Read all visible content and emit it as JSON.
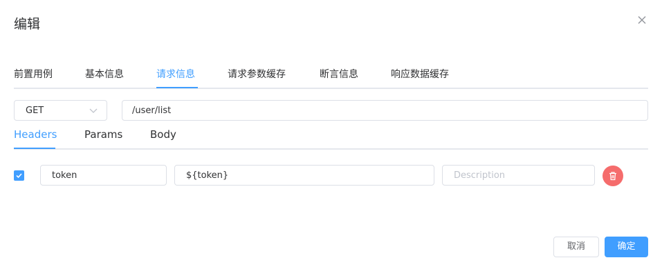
{
  "dialog": {
    "title": "编辑"
  },
  "tabs": [
    {
      "label": "前置用例"
    },
    {
      "label": "基本信息"
    },
    {
      "label": "请求信息",
      "active": true
    },
    {
      "label": "请求参数缓存"
    },
    {
      "label": "断言信息"
    },
    {
      "label": "响应数据缓存"
    }
  ],
  "request": {
    "method": "GET",
    "url": "/user/list"
  },
  "subtabs": [
    {
      "label": "Headers",
      "active": true
    },
    {
      "label": "Params"
    },
    {
      "label": "Body"
    }
  ],
  "headers": [
    {
      "enabled": true,
      "key": "token",
      "value": "${token}",
      "description": "",
      "description_placeholder": "Description"
    }
  ],
  "footer": {
    "cancel_label": "取消",
    "confirm_label": "确定"
  },
  "colors": {
    "accent": "#409eff",
    "danger": "#f56c6c",
    "border": "#dcdfe6"
  }
}
